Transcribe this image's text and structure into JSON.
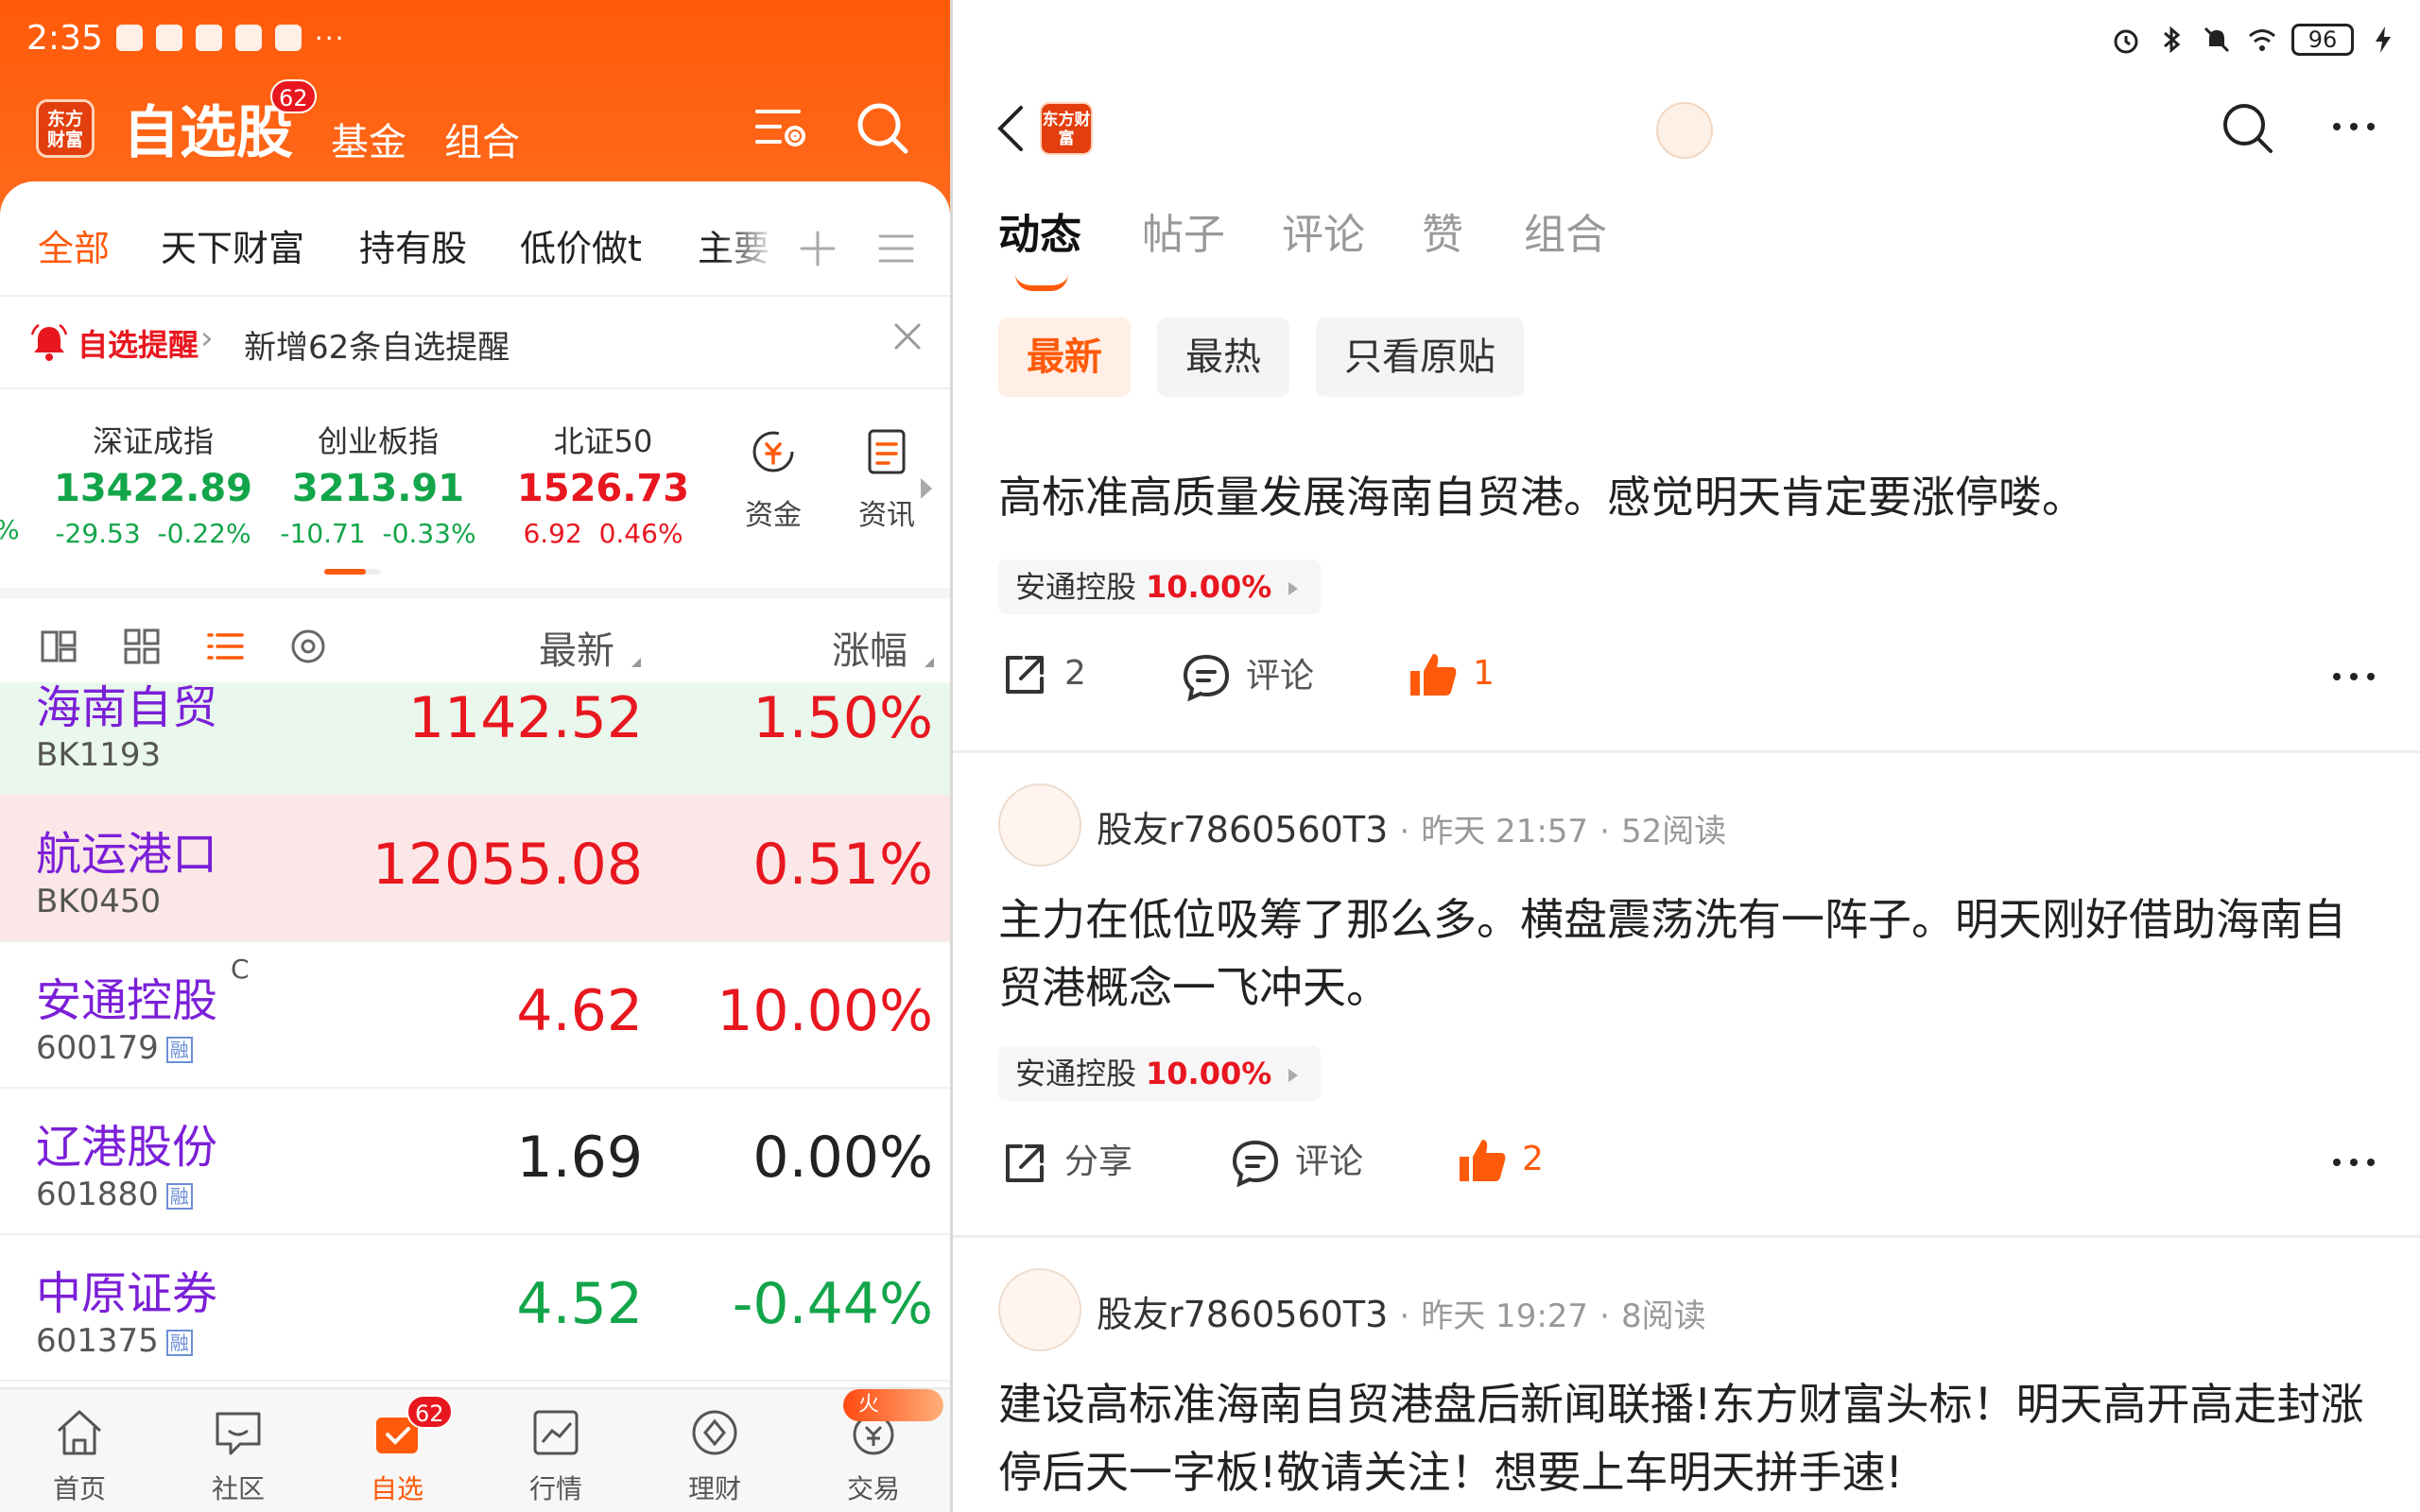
{
  "left": {
    "status_time": "2:35",
    "status_dots": "···",
    "brand_logo": "东方财富",
    "title": "自选股",
    "title_badge": "62",
    "header_tabs": [
      "基金",
      "组合"
    ],
    "group_tabs": [
      "全部",
      "天下财富",
      "持有股",
      "低价做t",
      "主要"
    ],
    "alert": {
      "tag": "自选提醒",
      "chevron": "›",
      "text": "新增62条自选提醒"
    },
    "indices": [
      {
        "name": "深证成指",
        "value": "13422.89",
        "change": "-29.53",
        "pct": "-0.22%",
        "color": "#13a54a"
      },
      {
        "name": "创业板指",
        "value": "3213.91",
        "change": "-10.71",
        "pct": "-0.33%",
        "color": "#13a54a"
      },
      {
        "name": "北证50",
        "value": "1526.73",
        "change": "6.92",
        "pct": "0.46%",
        "color": "#e8171f"
      }
    ],
    "index_edge": "%",
    "quick_links": [
      "资金",
      "资讯"
    ],
    "list_columns": {
      "price": "最新",
      "change": "涨幅"
    },
    "rows": [
      {
        "name": "海南自贸",
        "code": "BK1193",
        "price": "1142.52",
        "pct": "1.50%",
        "color": "#e8171f",
        "bg": "#e9f7ec",
        "rong": "",
        "sup": ""
      },
      {
        "name": "航运港口",
        "code": "BK0450",
        "price": "12055.08",
        "pct": "0.51%",
        "color": "#e8171f",
        "bg": "#fbe7e7",
        "rong": "",
        "sup": ""
      },
      {
        "name": "安通控股",
        "code": "600179",
        "price": "4.62",
        "pct": "10.00%",
        "color": "#e8171f",
        "bg": "#ffffff",
        "rong": "融",
        "sup": "C"
      },
      {
        "name": "辽港股份",
        "code": "601880",
        "price": "1.69",
        "pct": "0.00%",
        "color": "#222222",
        "bg": "#ffffff",
        "rong": "融",
        "sup": ""
      },
      {
        "name": "中原证券",
        "code": "601375",
        "price": "4.52",
        "pct": "-0.44%",
        "color": "#13a54a",
        "bg": "#ffffff",
        "rong": "融",
        "sup": ""
      }
    ],
    "nav": [
      {
        "label": "首页",
        "icon": "home-icon"
      },
      {
        "label": "社区",
        "icon": "community-icon"
      },
      {
        "label": "自选",
        "icon": "watchlist-icon",
        "badge": "62"
      },
      {
        "label": "行情",
        "icon": "market-icon"
      },
      {
        "label": "理财",
        "icon": "wealth-icon"
      },
      {
        "label": "交易",
        "icon": "trade-icon"
      }
    ],
    "fire_tag": "火",
    "accent": "#ff5a0a"
  },
  "right": {
    "battery": "96",
    "brand_logo": "东方财富",
    "tabs": [
      "动态",
      "帖子",
      "评论",
      "赞",
      "组合"
    ],
    "chips": [
      "最新",
      "最热",
      "只看原贴"
    ],
    "posts": [
      {
        "author": "",
        "time": "",
        "reads": "",
        "text": "高标准高质量发展海南自贸港。感觉明天肯定要涨停喽。",
        "stock": "安通控股",
        "stock_pct": "10.00%",
        "share": "2",
        "comment": "评论",
        "likes": "1"
      },
      {
        "author": "股友r7860560T3",
        "time": "昨天 21:57",
        "reads": "52阅读",
        "text": "主力在低位吸筹了那么多。横盘震荡洗有一阵子。明天刚好借助海南自贸港概念一飞冲天。",
        "stock": "安通控股",
        "stock_pct": "10.00%",
        "share": "分享",
        "comment": "评论",
        "likes": "2"
      },
      {
        "author": "股友r7860560T3",
        "time": "昨天 19:27",
        "reads": "8阅读",
        "text": "建设高标准海南自贸港盘后新闻联播!东方财富头标！明天高开高走封涨停后天一字板!敬请关注！想要上车明天拼手速!",
        "stock": "",
        "stock_pct": "",
        "share": "",
        "comment": "",
        "likes": ""
      }
    ],
    "meta_sep": "·"
  }
}
